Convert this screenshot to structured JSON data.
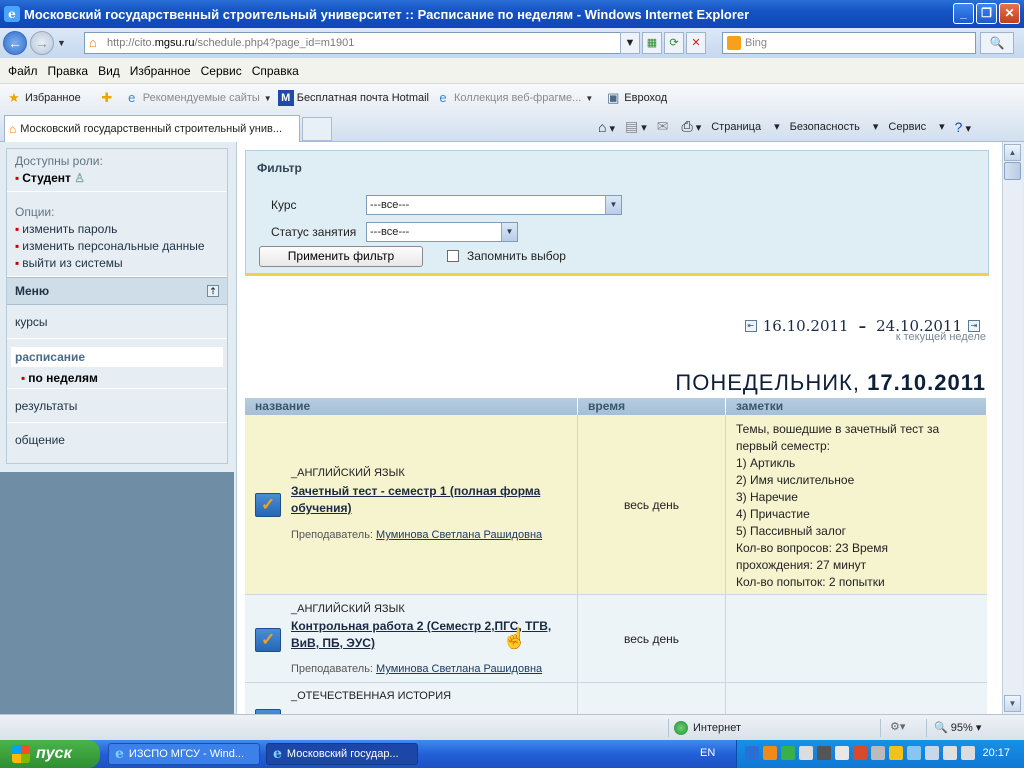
{
  "window": {
    "title": "Московский государственный строительный университет :: Расписание по неделям - Windows Internet Explorer"
  },
  "address": {
    "prefix": "http://cito.",
    "host": "mgsu.ru",
    "path": "/schedule.php4?page_id=m1901"
  },
  "search": {
    "placeholder": "Bing"
  },
  "menubar": [
    "Файл",
    "Правка",
    "Вид",
    "Избранное",
    "Сервис",
    "Справка"
  ],
  "favorites": {
    "label": "Избранное",
    "items": [
      "Рекомендуемые сайты",
      "Бесплатная почта Hotmail",
      "Коллекция веб-фрагме...",
      "Евроход"
    ]
  },
  "tab": {
    "title": "Московский государственный строительный унив..."
  },
  "commands": {
    "page": "Страница",
    "safety": "Безопасность",
    "tools": "Сервис"
  },
  "sidebar": {
    "roles_label": "Доступны роли:",
    "role": "Студент",
    "options_label": "Опции:",
    "options": [
      "изменить пароль",
      "изменить персональные данные",
      "выйти из системы"
    ],
    "menu_label": "Меню",
    "links": [
      "курсы",
      "расписание",
      "по неделям",
      "результаты",
      "общение"
    ]
  },
  "filter": {
    "title": "Фильтр",
    "course_label": "Курс",
    "course_value": "---все---",
    "status_label": "Статус занятия",
    "status_value": "---все---",
    "apply": "Применить фильтр",
    "remember": "Запомнить выбор"
  },
  "week": {
    "from": "16.10.2011",
    "to": "24.10.2011",
    "current": "к текущей неделе"
  },
  "day": {
    "name": "ПОНЕДЕЛЬНИК,",
    "date": "17.10.2011"
  },
  "table": {
    "headers": [
      "название",
      "время",
      "заметки"
    ],
    "rows": [
      {
        "subject": "_АНГЛИЙСКИЙ ЯЗЫК",
        "title": "Зачетный тест - семестр 1 (полная форма обучения)",
        "teacher_label": "Преподаватель:",
        "teacher": "Муминова Светлана Рашидовна",
        "time": "весь день",
        "notes": [
          "Темы, вошедшие в зачетный тест за",
          "первый семестр:",
          "1) Артикль",
          "2) Имя числительное",
          "3) Наречие",
          "4) Причастие",
          "5) Пассивный залог",
          "Кол-во вопросов: 23 Время",
          "прохождения: 27 минут",
          "Кол-во попыток: 2 попытки"
        ]
      },
      {
        "subject": "_АНГЛИЙСКИЙ ЯЗЫК",
        "title": "Контрольная работа 2 (Семестр 2,ПГС, ТГВ, ВиВ, ПБ, ЭУС)",
        "teacher_label": "Преподаватель:",
        "teacher": "Муминова Светлана Рашидовна",
        "time": "весь день"
      },
      {
        "subject": "_ОТЕЧЕСТВЕННАЯ ИСТОРИЯ"
      }
    ]
  },
  "status": {
    "zone": "Интернет",
    "zoom": "95%"
  },
  "taskbar": {
    "start": "пуск",
    "tasks": [
      "ИЗСПО МГСУ - Wind...",
      "Московский государ..."
    ],
    "lang": "EN",
    "clock": "20:17"
  }
}
